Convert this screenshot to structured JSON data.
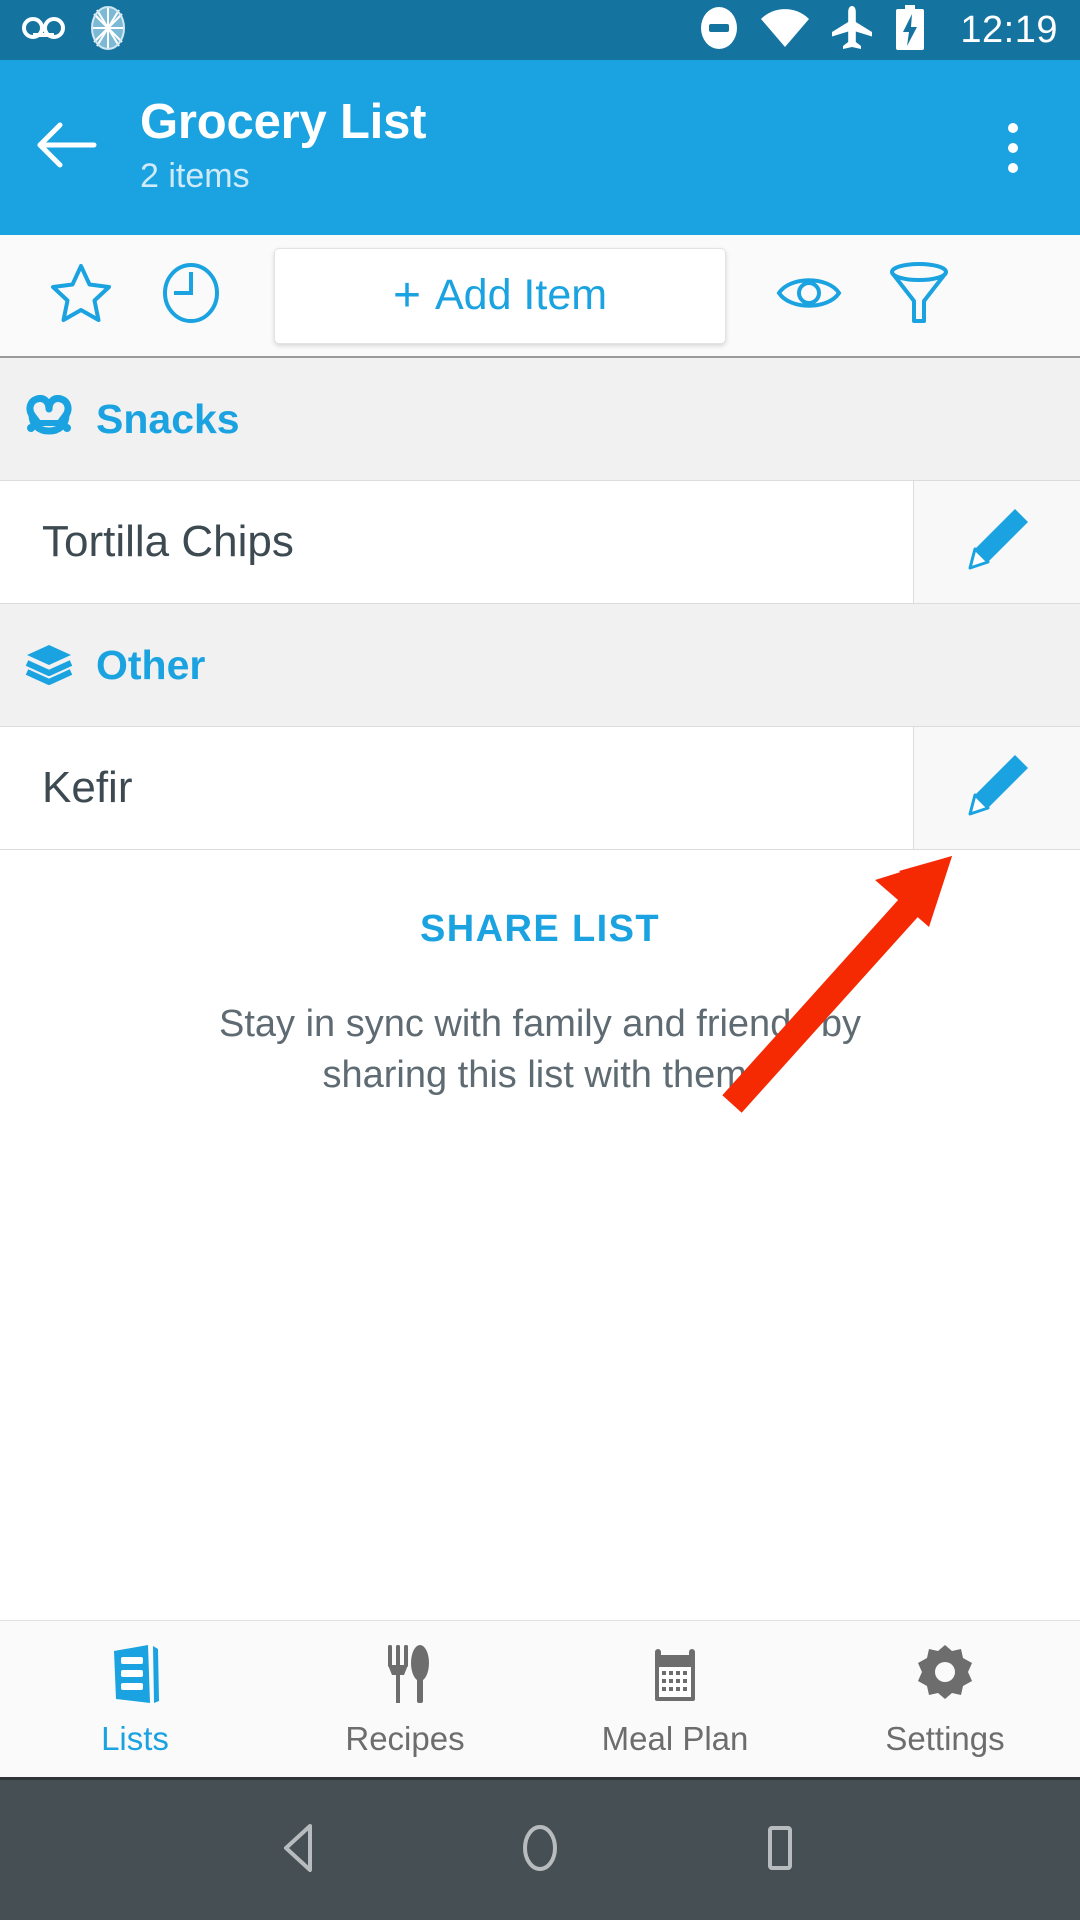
{
  "status_bar": {
    "time": "12:19",
    "background": "#15749f",
    "icons": [
      "voicemail-icon",
      "sync-spinner-icon",
      "do-not-disturb-icon",
      "wifi-icon",
      "airplane-mode-icon",
      "battery-charging-icon"
    ]
  },
  "app_bar": {
    "background": "#1aa3e0",
    "title": "Grocery List",
    "subtitle": "2 items",
    "back_icon": "back-arrow-icon",
    "overflow_icon": "overflow-menu-icon"
  },
  "toolbar": {
    "favorite_icon": "star-outline-icon",
    "history_icon": "clock-icon",
    "add_plus": "+",
    "add_label": "Add Item",
    "visibility_icon": "eye-icon",
    "filter_icon": "funnel-icon",
    "accent": "#1aa3e0"
  },
  "list": {
    "categories": [
      {
        "name": "Snacks",
        "icon": "pretzel-icon",
        "items": [
          {
            "name": "Tortilla Chips",
            "edit_icon": "pencil-icon"
          }
        ]
      },
      {
        "name": "Other",
        "icon": "layers-icon",
        "items": [
          {
            "name": "Kefir",
            "edit_icon": "pencil-icon"
          }
        ]
      }
    ]
  },
  "share": {
    "link_label": "SHARE LIST",
    "description": "Stay in sync with family and friends by sharing this list with them."
  },
  "bottom_nav": {
    "items": [
      {
        "label": "Lists",
        "icon": "lists-icon",
        "active": true
      },
      {
        "label": "Recipes",
        "icon": "fork-spoon-icon",
        "active": false
      },
      {
        "label": "Meal Plan",
        "icon": "calendar-icon",
        "active": false
      },
      {
        "label": "Settings",
        "icon": "gear-icon",
        "active": false
      }
    ],
    "active_color": "#1aa3e0",
    "inactive_color": "#6d6d6d"
  },
  "android_nav": {
    "background": "#464f54",
    "back_icon": "android-back-icon",
    "home_icon": "android-home-icon",
    "recents_icon": "android-recents-icon"
  },
  "annotation": {
    "arrow_color": "#f62a02",
    "points_to": "edit-button-kefir"
  }
}
